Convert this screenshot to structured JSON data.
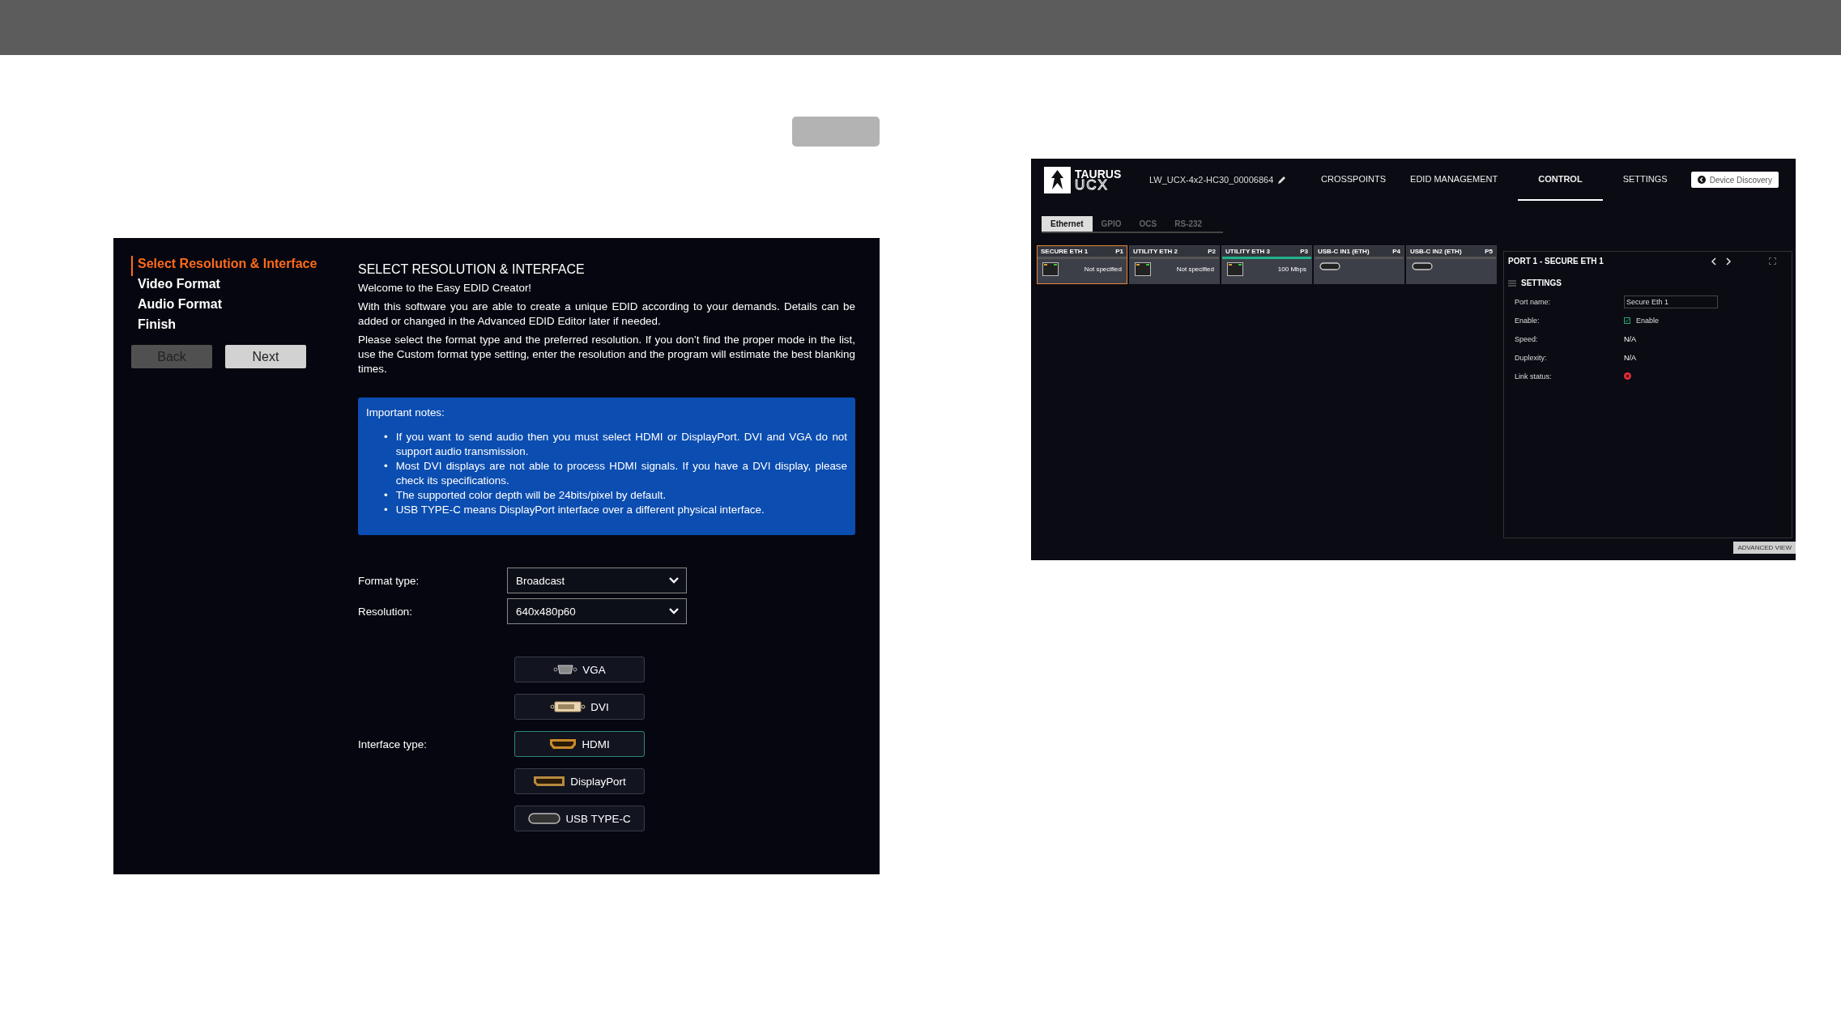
{
  "wizard": {
    "steps": [
      {
        "label": "Select Resolution & Interface",
        "selected": true
      },
      {
        "label": "Video Format",
        "selected": false
      },
      {
        "label": "Audio Format",
        "selected": false
      },
      {
        "label": "Finish",
        "selected": false
      }
    ],
    "buttons": [
      {
        "label": "Back",
        "disabled": true
      },
      {
        "label": "Next",
        "disabled": false
      }
    ],
    "title": "SELECT RESOLUTION & INTERFACE",
    "welcome": "Welcome to the Easy EDID Creator!",
    "paragraphs": [
      "With this software you are able to create a unique EDID according to your demands. Details can be added or changed in the Advanced EDID Editor later if needed.",
      "Please select the format type and the preferred resolution. If you don’t find the proper mode in the list, use the Custom format type setting, enter the resolution and the program will estimate the best blanking times."
    ],
    "notes": {
      "title": "Important notes:",
      "marker": "•",
      "items": [
        "If you want to send audio then you must select HDMI or DisplayPort. DVI and VGA do not support audio transmission.",
        "Most DVI displays are not able to process HDMI signals. If you have a DVI display, please check its specifications.",
        "The supported color depth will be 24bits/pixel by default.",
        "USB TYPE-C means DisplayPort interface over a different physical interface."
      ]
    },
    "fields": [
      {
        "label": "Format type:",
        "value": "Broadcast"
      },
      {
        "label": "Resolution:",
        "value": "640x480p60"
      }
    ],
    "interface_label": "Interface type:",
    "interfaces": [
      {
        "label": "VGA",
        "kind": "vga",
        "selected": false
      },
      {
        "label": "DVI",
        "kind": "dvi",
        "selected": false
      },
      {
        "label": "HDMI",
        "kind": "hdmi",
        "selected": true
      },
      {
        "label": "DisplayPort",
        "kind": "dp",
        "selected": false
      },
      {
        "label": "USB TYPE-C",
        "kind": "usbc",
        "selected": false
      }
    ]
  },
  "device": {
    "logo": {
      "top": "TAURUS",
      "bottom": "UCX"
    },
    "device_name": "LW_UCX-4x2-HC30_00006864",
    "nav": [
      {
        "label": "CROSSPOINTS",
        "selected": false
      },
      {
        "label": "EDID MANAGEMENT",
        "selected": false
      },
      {
        "label": "CONTROL",
        "selected": true
      },
      {
        "label": "SETTINGS",
        "selected": false
      }
    ],
    "discovery_button": "Device Discovery",
    "tabs": [
      {
        "label": "Ethernet",
        "selected": true
      },
      {
        "label": "GPIO",
        "selected": false
      },
      {
        "label": "OCS",
        "selected": false
      },
      {
        "label": "RS-232",
        "selected": false
      }
    ],
    "ports": [
      {
        "name": "SECURE ETH 1",
        "port": "P1",
        "kind": "rj45",
        "status": "Not specified",
        "selected": true,
        "active": false
      },
      {
        "name": "UTILITY ETH 2",
        "port": "P2",
        "kind": "rj45",
        "status": "Not specified",
        "selected": false,
        "active": false
      },
      {
        "name": "UTILITY ETH 3",
        "port": "P3",
        "kind": "rj45",
        "status": "100 Mbps",
        "selected": false,
        "active": true
      },
      {
        "name": "USB-C IN1 (ETH)",
        "port": "P4",
        "kind": "usbc",
        "selected": false,
        "active": false
      },
      {
        "name": "USB-C IN2 (ETH)",
        "port": "P5",
        "kind": "usbc",
        "selected": false,
        "active": false
      }
    ],
    "detail": {
      "title": "PORT 1 - SECURE ETH 1",
      "section": "SETTINGS",
      "rows": [
        {
          "label": "Port name:",
          "kind": "input",
          "value": "Secure Eth 1"
        },
        {
          "label": "Enable:",
          "kind": "checkbox",
          "value": "Enable",
          "checked": true
        },
        {
          "label": "Speed:",
          "kind": "text",
          "value": "N/A"
        },
        {
          "label": "Duplexity:",
          "kind": "text",
          "value": "N/A"
        },
        {
          "label": "Link status:",
          "kind": "status",
          "linked": false
        }
      ]
    },
    "advanced_button": "ADVANCED VIEW"
  }
}
